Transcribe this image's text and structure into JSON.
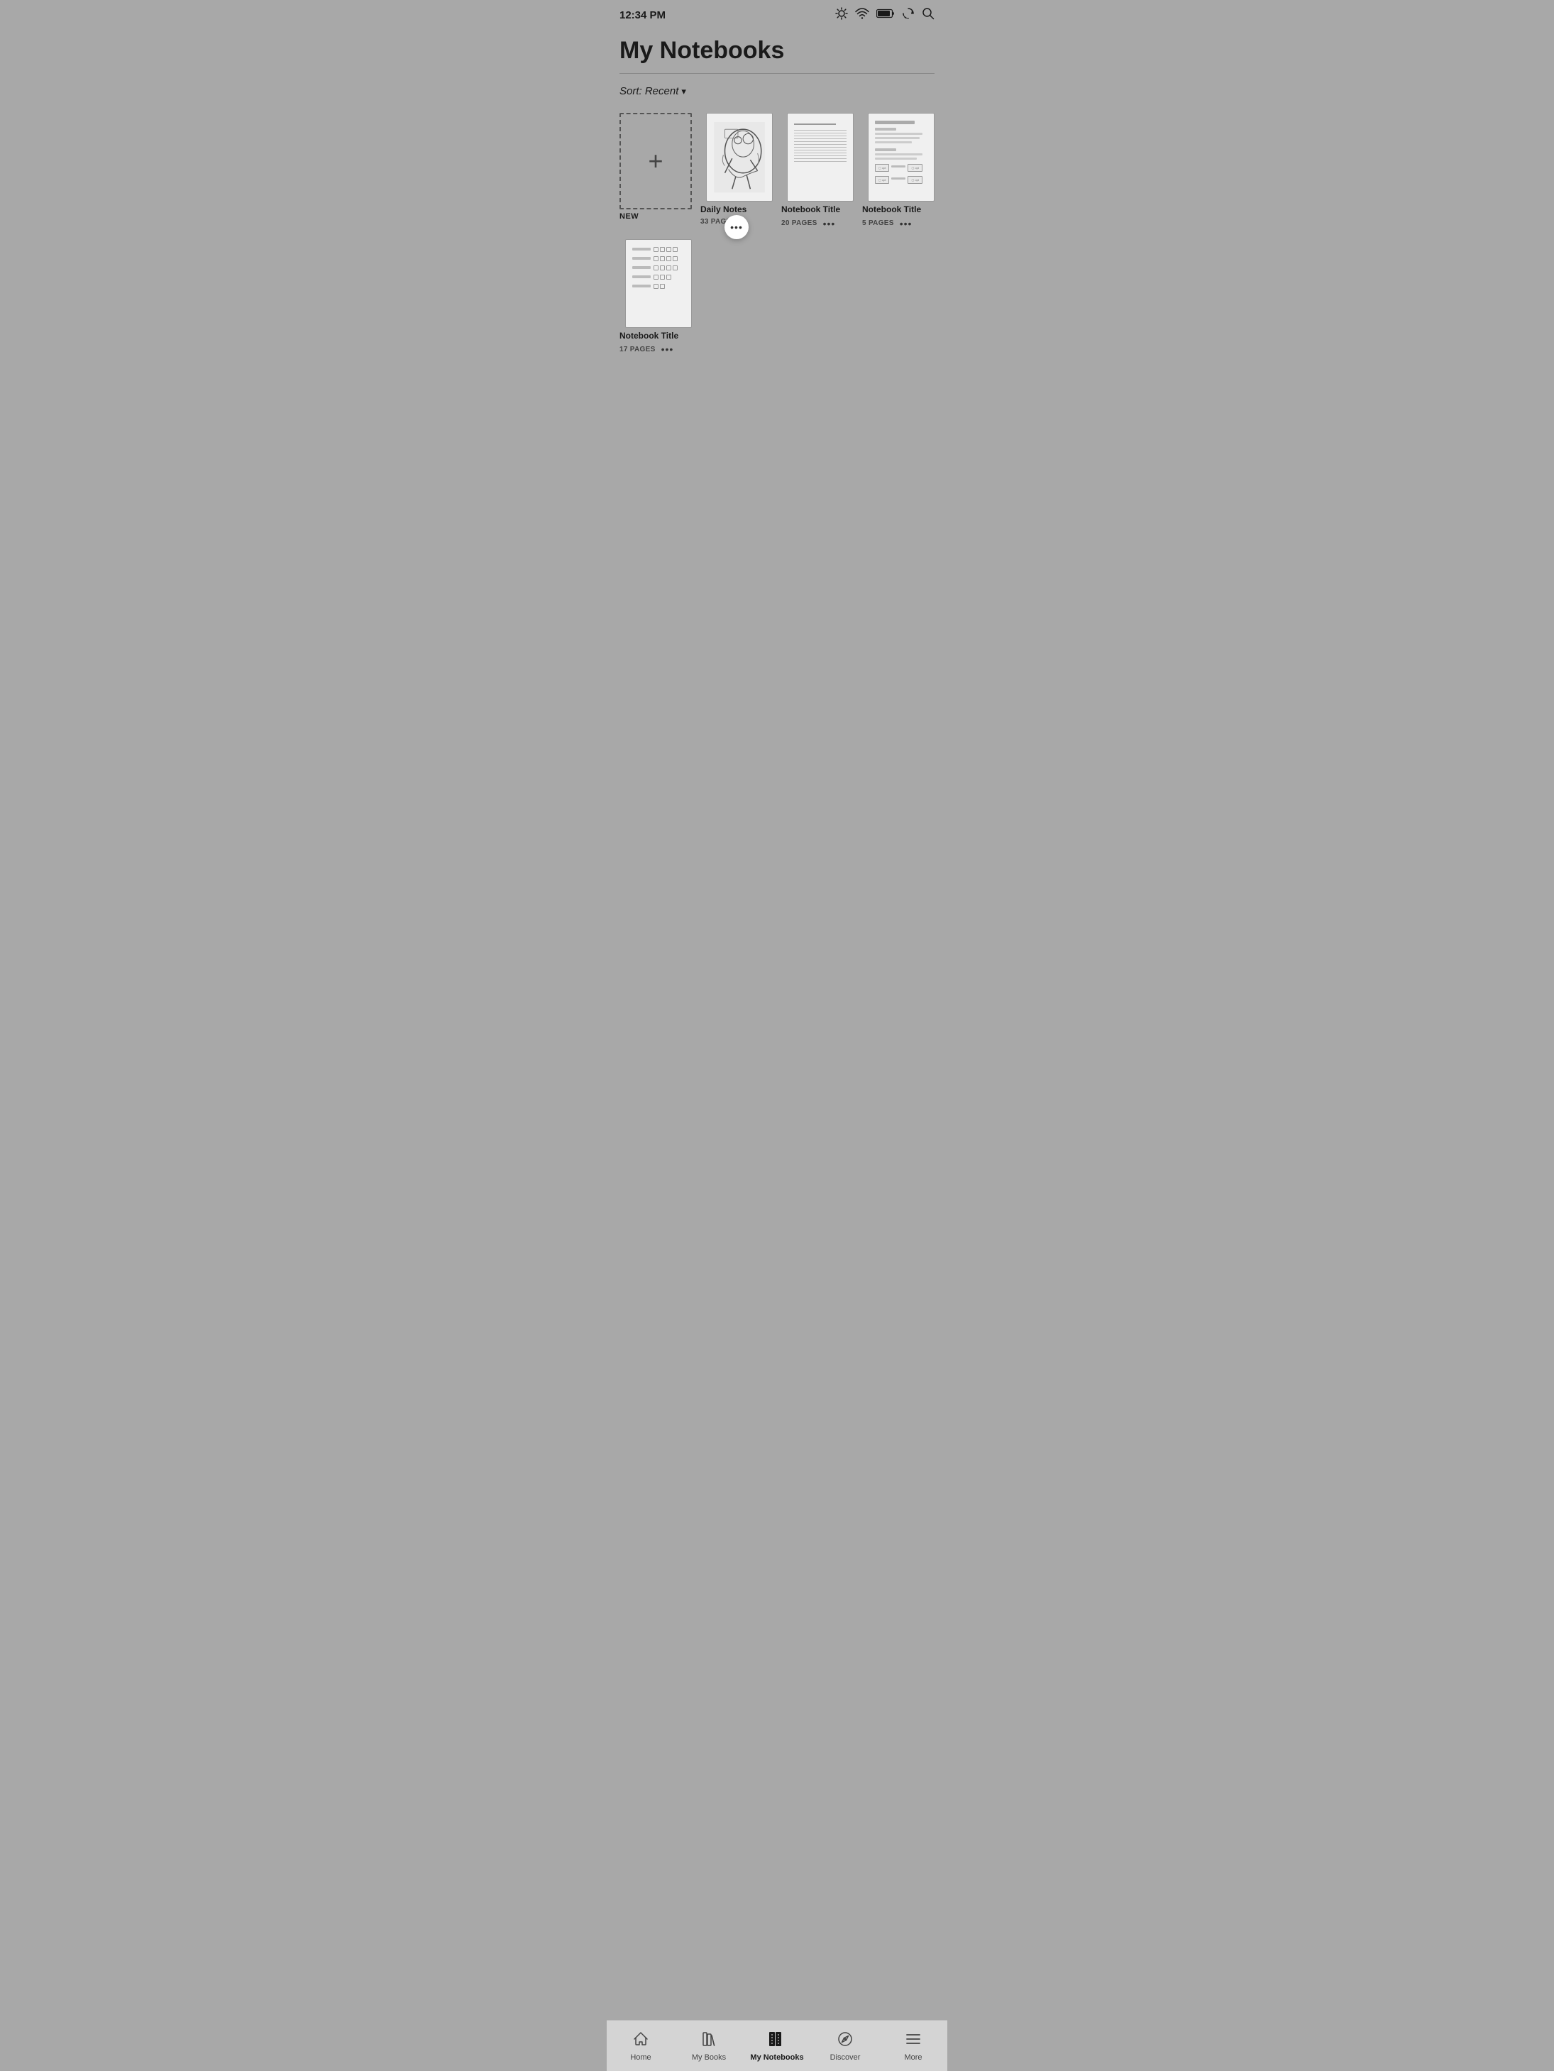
{
  "statusBar": {
    "time": "12:34 PM",
    "icons": [
      "brightness-icon",
      "wifi-icon",
      "battery-icon",
      "sync-icon",
      "search-icon"
    ]
  },
  "page": {
    "title": "My Notebooks",
    "sort": {
      "label": "Sort: Recent",
      "chevron": "▾"
    }
  },
  "notebooks": [
    {
      "id": "new",
      "type": "new",
      "label": "NEW"
    },
    {
      "id": "daily-notes",
      "type": "sketch",
      "title": "Daily Notes",
      "pages": "33 PAGES",
      "hasSpiral": true,
      "hasFloatingMore": true
    },
    {
      "id": "notebook-2",
      "type": "lined",
      "title": "Notebook Title",
      "pages": "20 PAGES",
      "hasSpiral": true
    },
    {
      "id": "notebook-3",
      "type": "toolkits",
      "title": "Notebook Title",
      "pages": "5 PAGES",
      "hasSpiral": true
    },
    {
      "id": "notebook-4",
      "type": "checkbox",
      "title": "Notebook Title",
      "pages": "17 PAGES",
      "hasSpiral": true
    }
  ],
  "nav": {
    "items": [
      {
        "id": "home",
        "label": "Home",
        "icon": "home-icon",
        "active": false
      },
      {
        "id": "my-books",
        "label": "My Books",
        "icon": "books-icon",
        "active": false
      },
      {
        "id": "my-notebooks",
        "label": "My Notebooks",
        "icon": "notebooks-icon",
        "active": true
      },
      {
        "id": "discover",
        "label": "Discover",
        "icon": "discover-icon",
        "active": false
      },
      {
        "id": "more",
        "label": "More",
        "icon": "more-icon",
        "active": false
      }
    ]
  },
  "dots": "•••",
  "plus": "+"
}
